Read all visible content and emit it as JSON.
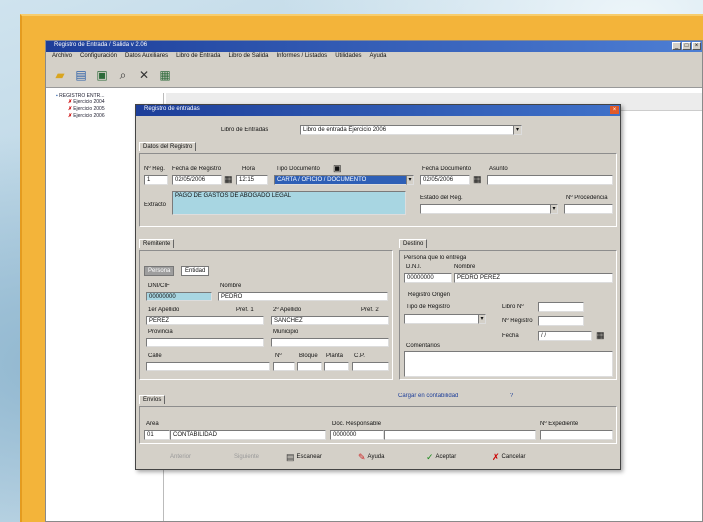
{
  "app": {
    "title": "Registro de Entrada / Salida v 2.06",
    "menu": [
      "Archivo",
      "Configuración",
      "Datos Auxiliares",
      "Libro de Entrada",
      "Libro de Salida",
      "Informes / Listados",
      "Utilidades",
      "Ayuda"
    ],
    "toolbar_icons": [
      "folder-icon",
      "print-icon",
      "book-icon",
      "search-icon",
      "x-icon",
      "document-icon"
    ]
  },
  "tree": {
    "root": "REGISTRO ENTR...",
    "items": [
      "Ejercicio 2004",
      "Ejercicio 2005",
      "Ejercicio 2006"
    ]
  },
  "dialog": {
    "title": "Registro de entradas",
    "libro_label": "Libro de Entradas",
    "libro_value": "Libro de entrada Ejercicio 2006",
    "tab_main": "Datos del Registro",
    "headers": {
      "nreg": "Nº Reg.",
      "fecha_registro": "Fecha de Registro",
      "hora": "Hora",
      "tipo_documento": "Tipo Documento",
      "fecha_documento": "Fecha Documento",
      "asunto": "Asunto"
    },
    "values": {
      "nreg": "1",
      "fecha_registro": "02/05/2006",
      "hora": "12:15",
      "tipo_documento": "CARTA / OFICIO / DOCUMENTO",
      "fecha_documento": "02/05/2006",
      "asunto": ""
    },
    "extracto_label": "Extracto",
    "extracto_value": "PAGO DE GASTOS DE ABOGADO LEGAL",
    "estado_label": "Estado del Reg.",
    "nprocedencia_label": "Nº Procedencia",
    "remitente_tab": "Remitente",
    "subtab_persona": "Persona",
    "subtab_entidad": "Entidad",
    "persona_fields": {
      "dni_label": "DNI/CIF",
      "dni_value": "00000000",
      "nombre_label": "Nombre",
      "nombre_value": "PEDRO",
      "apellido1_label": "1er Apellido",
      "apellido1_value": "PEREZ",
      "apellido2_label": "2º Apellido",
      "apellido2_value": "SANCHEZ",
      "pref1_label": "Pref. 1",
      "pref2_label": "Pref. 2",
      "provincia_label": "Provincia",
      "municipio_label": "Municipio",
      "calle_label": "Calle",
      "num_label": "Nº",
      "bloque_label": "Bloque",
      "planta_label": "Planta",
      "cp_label": "C.P."
    },
    "destino_tab": "Destino",
    "destino_fields": {
      "persona_label": "Persona que lo entrega",
      "dni_label": "D.N.I.",
      "nombre_label": "Nombre",
      "dni_value": "00000000",
      "nombre_value": "PEDRO PEREZ",
      "registro_label": "Registro Origen",
      "tipo_label": "Tipo de Registro",
      "libro_label": "Libro Nº",
      "nregistro_label": "Nº Registro",
      "fecha_label": "Fecha",
      "fecha_value": "/ /",
      "comentarios_label": "Comentarios"
    },
    "envios_tab": "Envíos",
    "cargo_label": "Cargar en contabilidad",
    "cargo_value": "?",
    "envio_fields": {
      "area_label": "Área",
      "area_code": "01",
      "area_value": "CONTABILIDAD",
      "doc_label": "Doc. Responsable",
      "doc_value": "0000000",
      "nexpediente_label": "Nº Expediente"
    },
    "buttons": {
      "anterior": "Anterior",
      "siguiente": "Siguiente",
      "escanear": "Escanear",
      "ayuda": "Ayuda",
      "aceptar": "Aceptar",
      "cancelar": "Cancelar"
    }
  }
}
